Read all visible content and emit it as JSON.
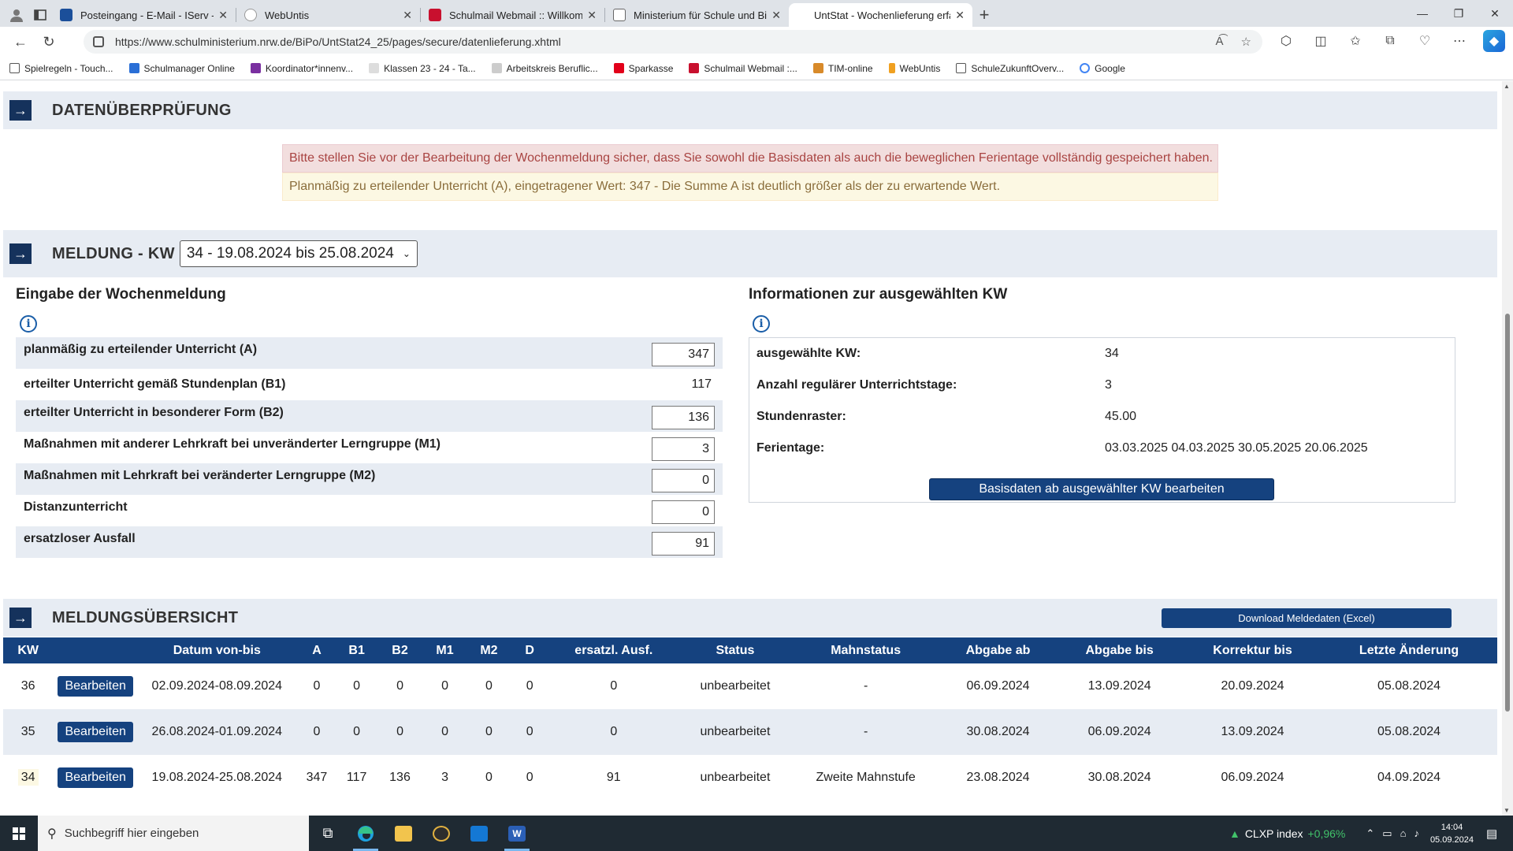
{
  "browser": {
    "tabs": [
      {
        "label": "Posteingang - E-Mail - IServ - rkr...",
        "color": "#1b4f9a"
      },
      {
        "label": "WebUntis",
        "color": "#e4e7ea"
      },
      {
        "label": "Schulmail Webmail :: Willkommen",
        "color": "#c8102e"
      },
      {
        "label": "Ministerium für Schule und Bildung",
        "color": "#e4e7ea"
      },
      {
        "label": "UntStat - Wochenlieferung erfass...",
        "color": "#e4e7ea"
      }
    ],
    "new_tab_label": "+",
    "url": "https://www.schulministerium.nrw.de/BiPo/UntStat24_25/pages/secure/datenlieferung.xhtml",
    "bookmarks": [
      {
        "label": "Spielregeln - Touch...",
        "color": "#555555"
      },
      {
        "label": "Schulmanager Online",
        "color": "#2a6fd6"
      },
      {
        "label": "Koordinator*innenv...",
        "color": "#7a2fa0"
      },
      {
        "label": "Klassen 23 - 24 - Ta...",
        "color": "#888888"
      },
      {
        "label": "Arbeitskreis Beruflic...",
        "color": "#999999"
      },
      {
        "label": "Sparkasse",
        "color": "#e2001a"
      },
      {
        "label": "Schulmail Webmail :...",
        "color": "#c8102e"
      },
      {
        "label": "TIM-online",
        "color": "#d88a2a"
      },
      {
        "label": "WebUntis",
        "color": "#f0a020"
      },
      {
        "label": "SchuleZukunftOverv...",
        "color": "#555555"
      },
      {
        "label": "Google",
        "color": "#4285f4"
      }
    ]
  },
  "sections": {
    "check_title": "DATENÜBERPRÜFUNG",
    "alert_red": "Bitte stellen Sie vor der Bearbeitung der Wochenmeldung sicher, dass Sie sowohl die Basisdaten als auch die beweglichen Ferientage vollständig gespeichert haben.",
    "alert_yellow": "Planmäßig zu erteilender Unterricht (A), eingetragener Wert: 347 - Die Summe A ist deutlich größer als der zu erwartende Wert.",
    "report_title": "MELDUNG - KW",
    "kw_selected": "34 - 19.08.2024 bis 25.08.2024",
    "overview_title": "MELDUNGSÜBERSICHT",
    "download_label": "Download Meldedaten (Excel)"
  },
  "form": {
    "title": "Eingabe der Wochenmeldung",
    "info_glyph": "i",
    "rows": [
      {
        "label": "planmäßig zu erteilender Unterricht (A)",
        "value": "347"
      },
      {
        "label": "erteilter Unterricht gemäß Stundenplan (B1)",
        "value": "117"
      },
      {
        "label": "erteilter Unterricht in besonderer Form (B2)",
        "value": "136"
      },
      {
        "label": "Maßnahmen mit anderer Lehrkraft bei unveränderter Lerngruppe (M1)",
        "value": "3"
      },
      {
        "label": "Maßnahmen mit Lehrkraft bei veränderter Lerngruppe (M2)",
        "value": "0"
      },
      {
        "label": "Distanzunterricht",
        "value": "0"
      },
      {
        "label": "ersatzloser Ausfall",
        "value": "91"
      }
    ]
  },
  "info": {
    "title": "Informationen zur ausgewählten KW",
    "rows": [
      {
        "label": "ausgewählte KW:",
        "value": "34"
      },
      {
        "label": "Anzahl regulärer Unterrichtstage:",
        "value": "3"
      },
      {
        "label": "Stundenraster:",
        "value": "45.00"
      },
      {
        "label": "Ferientage:",
        "value": "03.03.2025 04.03.2025 30.05.2025 20.06.2025"
      }
    ],
    "button_label": "Basisdaten ab ausgewählter KW bearbeiten"
  },
  "overview": {
    "headers": [
      "KW",
      "",
      "Datum von-bis",
      "A",
      "B1",
      "B2",
      "M1",
      "M2",
      "D",
      "ersatzl. Ausf.",
      "Status",
      "Mahnstatus",
      "Abgabe ab",
      "Abgabe bis",
      "Korrektur bis",
      "Letzte Änderung"
    ],
    "edit_label": "Bearbeiten",
    "rows": [
      {
        "kw": "36",
        "datum": "02.09.2024-08.09.2024",
        "a": "0",
        "b1": "0",
        "b2": "0",
        "m1": "0",
        "m2": "0",
        "d": "0",
        "ausf": "0",
        "status": "unbearbeitet",
        "mahn": "-",
        "ab": "06.09.2024",
        "bis": "13.09.2024",
        "korr": "20.09.2024",
        "aend": "05.08.2024"
      },
      {
        "kw": "35",
        "datum": "26.08.2024-01.09.2024",
        "a": "0",
        "b1": "0",
        "b2": "0",
        "m1": "0",
        "m2": "0",
        "d": "0",
        "ausf": "0",
        "status": "unbearbeitet",
        "mahn": "-",
        "ab": "30.08.2024",
        "bis": "06.09.2024",
        "korr": "13.09.2024",
        "aend": "05.08.2024"
      },
      {
        "kw": "34",
        "datum": "19.08.2024-25.08.2024",
        "a": "347",
        "b1": "117",
        "b2": "136",
        "m1": "3",
        "m2": "0",
        "d": "0",
        "ausf": "91",
        "status": "unbearbeitet",
        "mahn": "Zweite Mahnstufe",
        "ab": "23.08.2024",
        "bis": "30.08.2024",
        "korr": "06.09.2024",
        "aend": "04.09.2024"
      }
    ]
  },
  "taskbar": {
    "search_placeholder": "Suchbegriff hier eingeben",
    "ticker_label": "CLXP index",
    "ticker_value": "+0,96%",
    "time": "14:04",
    "date": "05.09.2024"
  },
  "colors": {
    "header_blue": "#15427f",
    "section_bg": "#e7ecf3",
    "alert_red_text": "#a94442",
    "alert_yellow_text": "#8a6d3b"
  }
}
